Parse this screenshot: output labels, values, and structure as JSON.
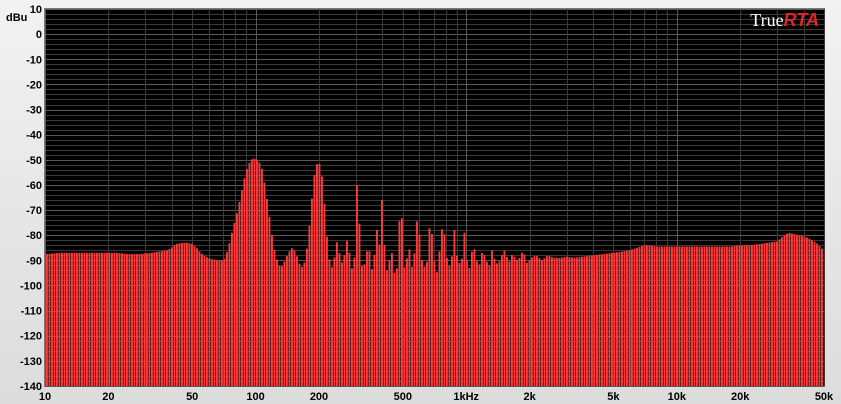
{
  "app": {
    "logo_part1": "True",
    "logo_part2": "RTA"
  },
  "colors": {
    "bars": "#ff3838",
    "background": "#000000",
    "grid": "#3a3a3a",
    "grid_major": "#5a5a5a",
    "accent": "#e0252b"
  },
  "chart_data": {
    "type": "bar",
    "y_unit_label": "dBu",
    "xscale": "log",
    "xlim": [
      10,
      50000
    ],
    "ylim": [
      -140,
      10
    ],
    "grid": true,
    "x_ticks": [
      10,
      20,
      50,
      100,
      200,
      500,
      1000,
      2000,
      5000,
      10000,
      20000,
      50000
    ],
    "x_tick_labels": [
      "10",
      "20",
      "50",
      "100",
      "200",
      "500",
      "1kHz",
      "2k",
      "5k",
      "10k",
      "20k",
      "50k"
    ],
    "y_ticks": [
      10,
      0,
      -10,
      -20,
      -30,
      -40,
      -50,
      -60,
      -70,
      -80,
      -90,
      -100,
      -110,
      -120,
      -130,
      -140
    ],
    "y_tick_labels": [
      "10",
      "0",
      "-10",
      "-20",
      "-30",
      "-40",
      "-50",
      "-60",
      "-70",
      "-80",
      "-90",
      "-100",
      "-110",
      "-120",
      "-130",
      "-140"
    ],
    "spectrum_points": [
      [
        10,
        -87.5
      ],
      [
        12,
        -87
      ],
      [
        15,
        -87
      ],
      [
        18,
        -87
      ],
      [
        20,
        -87
      ],
      [
        22,
        -87
      ],
      [
        25,
        -87.5
      ],
      [
        28,
        -87.5
      ],
      [
        32,
        -87
      ],
      [
        35,
        -86.5
      ],
      [
        38,
        -86
      ],
      [
        40,
        -85
      ],
      [
        42,
        -83.5
      ],
      [
        45,
        -83
      ],
      [
        48,
        -83
      ],
      [
        50,
        -83.5
      ],
      [
        52,
        -84.5
      ],
      [
        55,
        -87
      ],
      [
        58,
        -88.5
      ],
      [
        62,
        -89.5
      ],
      [
        66,
        -90
      ],
      [
        70,
        -90
      ],
      [
        72,
        -89
      ],
      [
        75,
        -84
      ],
      [
        78,
        -78
      ],
      [
        82,
        -71
      ],
      [
        86,
        -63
      ],
      [
        90,
        -55
      ],
      [
        94,
        -51
      ],
      [
        97,
        -49.5
      ],
      [
        100,
        -49.5
      ],
      [
        104,
        -50.5
      ],
      [
        108,
        -54
      ],
      [
        112,
        -62
      ],
      [
        116,
        -71
      ],
      [
        120,
        -80
      ],
      [
        124,
        -87
      ],
      [
        128,
        -91
      ],
      [
        132,
        -93
      ],
      [
        136,
        -91.5
      ],
      [
        140,
        -89
      ],
      [
        145,
        -86.5
      ],
      [
        150,
        -85
      ],
      [
        155,
        -86.5
      ],
      [
        160,
        -90
      ],
      [
        165,
        -93
      ],
      [
        170,
        -92
      ],
      [
        175,
        -87
      ],
      [
        180,
        -78
      ],
      [
        185,
        -67
      ],
      [
        190,
        -57
      ],
      [
        195,
        -52
      ],
      [
        200,
        -51
      ],
      [
        205,
        -53
      ],
      [
        210,
        -61
      ],
      [
        215,
        -72
      ],
      [
        220,
        -83
      ],
      [
        226,
        -91
      ],
      [
        232,
        -93
      ],
      [
        240,
        -87
      ],
      [
        245,
        -82
      ],
      [
        250,
        -86
      ],
      [
        255,
        -92
      ],
      [
        265,
        -88
      ],
      [
        272,
        -82
      ],
      [
        278,
        -85
      ],
      [
        285,
        -92
      ],
      [
        292,
        -95
      ],
      [
        298,
        -85
      ],
      [
        302,
        -62
      ],
      [
        306,
        -58
      ],
      [
        310,
        -67
      ],
      [
        316,
        -89
      ],
      [
        325,
        -95
      ],
      [
        335,
        -88
      ],
      [
        345,
        -84
      ],
      [
        352,
        -89
      ],
      [
        360,
        -95
      ],
      [
        370,
        -86
      ],
      [
        378,
        -78
      ],
      [
        384,
        -76
      ],
      [
        390,
        -86
      ],
      [
        398,
        -67
      ],
      [
        402,
        -64
      ],
      [
        406,
        -74
      ],
      [
        415,
        -94
      ],
      [
        430,
        -94
      ],
      [
        440,
        -83
      ],
      [
        448,
        -89
      ],
      [
        458,
        -95
      ],
      [
        470,
        -94
      ],
      [
        482,
        -76
      ],
      [
        490,
        -68
      ],
      [
        498,
        -74
      ],
      [
        510,
        -93
      ],
      [
        530,
        -88
      ],
      [
        542,
        -85
      ],
      [
        555,
        -93
      ],
      [
        578,
        -84
      ],
      [
        590,
        -69
      ],
      [
        602,
        -80
      ],
      [
        622,
        -92
      ],
      [
        650,
        -93
      ],
      [
        680,
        -71
      ],
      [
        700,
        -88
      ],
      [
        728,
        -95
      ],
      [
        760,
        -82
      ],
      [
        780,
        -73
      ],
      [
        805,
        -88
      ],
      [
        850,
        -94
      ],
      [
        878,
        -76
      ],
      [
        905,
        -88
      ],
      [
        950,
        -93
      ],
      [
        982,
        -78
      ],
      [
        1010,
        -90
      ],
      [
        1050,
        -94
      ],
      [
        1080,
        -82
      ],
      [
        1110,
        -88
      ],
      [
        1150,
        -93
      ],
      [
        1200,
        -86
      ],
      [
        1240,
        -89
      ],
      [
        1290,
        -93
      ],
      [
        1320,
        -85
      ],
      [
        1360,
        -89
      ],
      [
        1420,
        -92
      ],
      [
        1480,
        -88
      ],
      [
        1530,
        -86
      ],
      [
        1600,
        -91
      ],
      [
        1670,
        -87
      ],
      [
        1730,
        -90
      ],
      [
        1800,
        -89
      ],
      [
        1870,
        -86
      ],
      [
        1950,
        -91
      ],
      [
        2050,
        -89
      ],
      [
        2150,
        -88
      ],
      [
        2300,
        -90
      ],
      [
        2450,
        -88
      ],
      [
        2600,
        -89
      ],
      [
        2800,
        -89
      ],
      [
        3000,
        -88.5
      ],
      [
        3300,
        -89
      ],
      [
        3600,
        -88.5
      ],
      [
        4000,
        -88
      ],
      [
        4500,
        -87.5
      ],
      [
        5000,
        -87
      ],
      [
        5500,
        -86.5
      ],
      [
        6000,
        -86
      ],
      [
        6500,
        -85
      ],
      [
        7000,
        -84
      ],
      [
        7500,
        -84
      ],
      [
        8000,
        -84.5
      ],
      [
        9000,
        -84.5
      ],
      [
        10000,
        -84.5
      ],
      [
        11000,
        -84.5
      ],
      [
        12500,
        -84.5
      ],
      [
        14000,
        -84.5
      ],
      [
        16000,
        -84.5
      ],
      [
        18000,
        -84.5
      ],
      [
        20000,
        -84
      ],
      [
        22000,
        -84
      ],
      [
        25000,
        -83.5
      ],
      [
        27000,
        -83
      ],
      [
        30000,
        -82.5
      ],
      [
        32000,
        -80.5
      ],
      [
        34000,
        -79
      ],
      [
        36000,
        -79.5
      ],
      [
        38000,
        -80
      ],
      [
        40000,
        -80.5
      ],
      [
        42000,
        -81
      ],
      [
        44000,
        -82
      ],
      [
        46000,
        -83
      ],
      [
        48000,
        -84.5
      ],
      [
        50000,
        -86
      ]
    ]
  }
}
